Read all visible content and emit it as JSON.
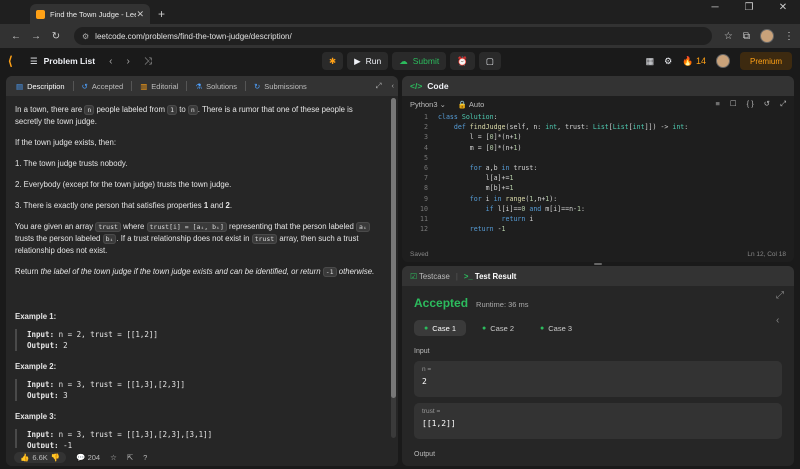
{
  "browser": {
    "tab_title": "Find the Town Judge - LeetCod",
    "url": "leetcode.com/problems/find-the-town-judge/description/"
  },
  "header": {
    "problem_list": "Problem List",
    "run": "Run",
    "submit": "Submit",
    "streak": "14",
    "premium": "Premium"
  },
  "left": {
    "tabs": [
      "Description",
      "Accepted",
      "Editorial",
      "Solutions",
      "Submissions"
    ],
    "p1a": "In a town, there are ",
    "p1n": "n",
    "p1b": " people labeled from ",
    "p1one": "1",
    "p1c": " to ",
    "p1n2": "n",
    "p1d": ". There is a rumor that one of these people is secretly the town judge.",
    "p2": "If the town judge exists, then:",
    "l1": "1. The town judge trusts nobody.",
    "l2": "2. Everybody (except for the town judge) trusts the town judge.",
    "l3a": "3. There is exactly one person that satisfies properties ",
    "l3b": "1",
    "l3c": " and ",
    "l3d": "2",
    "l3e": ".",
    "p3a": "You are given an array ",
    "p3trust": "trust",
    "p3b": " where ",
    "p3code": "trust[i] = [aᵢ, bᵢ]",
    "p3c": " representing that the person labeled ",
    "p3ai": "aᵢ",
    "p3d": " trusts the person labeled ",
    "p3bi": "bᵢ",
    "p3e": ". If a trust relationship does not exist in ",
    "p3trust2": "trust",
    "p3f": " array, then such a trust relationship does not exist.",
    "p4a": "Return ",
    "p4b": "the label of the town judge if the town judge exists and can be identified, or return ",
    "p4c": "-1",
    "p4d": " otherwise.",
    "examples": [
      {
        "title": "Example 1:",
        "input": "n = 2, trust = [[1,2]]",
        "output": "2"
      },
      {
        "title": "Example 2:",
        "input": "n = 3, trust = [[1,3],[2,3]]",
        "output": "3"
      },
      {
        "title": "Example 3:",
        "input": "n = 3, trust = [[1,3],[2,3],[3,1]]",
        "output": "-1"
      }
    ],
    "input_label": "Input:",
    "output_label": "Output:",
    "likes": "6.6K",
    "comments": "204"
  },
  "code": {
    "title": "Code",
    "lang": "Python3",
    "auto": "Auto",
    "saved": "Saved",
    "pos": "Ln 12, Col 18"
  },
  "result": {
    "tab1": "Testcase",
    "tab2": "Test Result",
    "status": "Accepted",
    "runtime": "Runtime: 36 ms",
    "cases": [
      "Case 1",
      "Case 2",
      "Case 3"
    ],
    "input_label": "Input",
    "n_name": "n =",
    "n_val": "2",
    "t_name": "trust =",
    "t_val": "[[1,2]]",
    "output_label": "Output"
  }
}
